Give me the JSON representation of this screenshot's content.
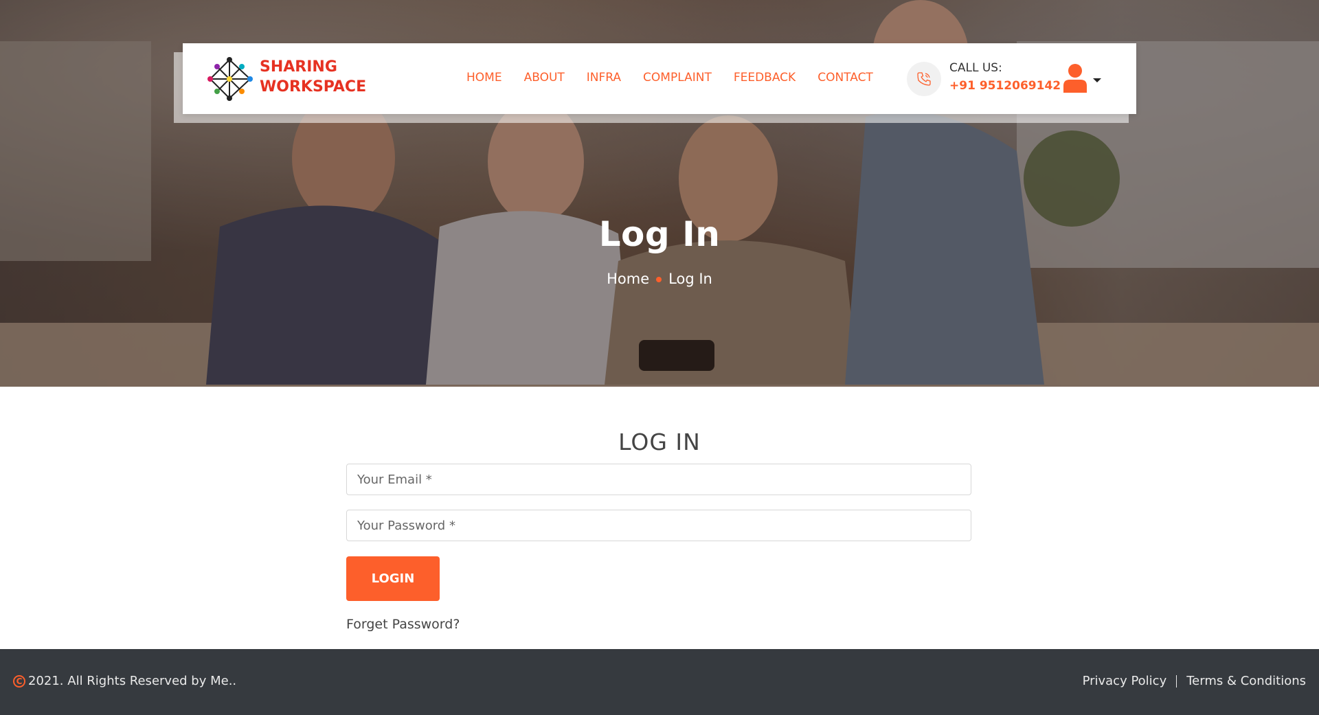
{
  "header": {
    "logo": {
      "line1": "SHARING",
      "line2": "WORKSPACE"
    },
    "nav": [
      {
        "label": "HOME"
      },
      {
        "label": "ABOUT"
      },
      {
        "label": "INFRA"
      },
      {
        "label": "COMPLAINT"
      },
      {
        "label": "FEEDBACK"
      },
      {
        "label": "CONTACT"
      }
    ],
    "call_label": "CALL US:",
    "call_number": "+91 9512069142",
    "icons": {
      "phone": "phone-icon",
      "user": "user-icon",
      "dropdown": "caret-down-icon"
    }
  },
  "hero": {
    "title": "Log In",
    "breadcrumb": {
      "home": "Home",
      "current": "Log In"
    }
  },
  "login": {
    "heading": "LOG IN",
    "email_placeholder": "Your Email *",
    "password_placeholder": "Your Password *",
    "button_label": "LOGIN",
    "forget_link": "Forget Password?"
  },
  "footer": {
    "copyright": "2021. All Rights Reserved by Me..",
    "links": {
      "privacy": "Privacy Policy",
      "terms": "Terms & Conditions"
    }
  },
  "colors": {
    "accent": "#fd5f2b",
    "logo_red": "#e63222",
    "footer_bg": "#363a3f"
  }
}
